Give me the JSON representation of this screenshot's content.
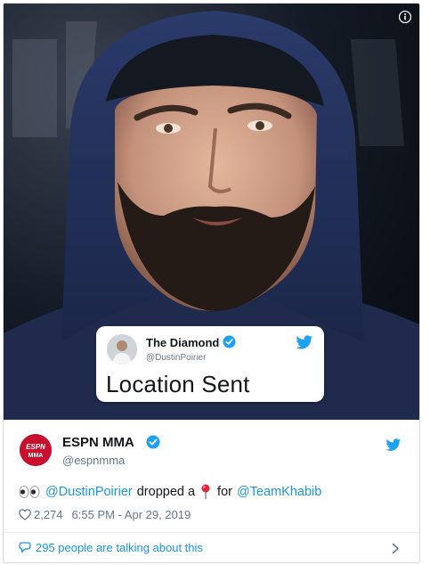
{
  "quoted_tweet": {
    "name": "The Diamond",
    "handle": "@DustinPoirier",
    "text": "Location Sent"
  },
  "tweet": {
    "author_name": "ESPN MMA",
    "author_handle": "@espnmma",
    "avatar_text_top": "ESPN",
    "avatar_text_bottom": "MMA",
    "text_parts": {
      "mention_1": "@DustinPoirier",
      "middle": "dropped a",
      "after_pin": "for",
      "mention_2": "@TeamKhabib"
    },
    "likes": "2,274",
    "timestamp": "6:55 PM - Apr 29, 2019",
    "talking": "295 people are talking about this"
  },
  "icons": {
    "info": "info-icon",
    "verified": "verified-badge-icon",
    "bird": "twitter-bird-icon",
    "eyes": "eyes-emoji",
    "pin": "round-pushpin-emoji",
    "heart": "heart-icon",
    "talk": "speech-bubble-icon",
    "chevron": "chevron-right-icon"
  },
  "colors": {
    "link": "#1b95e0",
    "muted": "#657786",
    "text": "#14171a",
    "espn_red": "#c8102e"
  }
}
